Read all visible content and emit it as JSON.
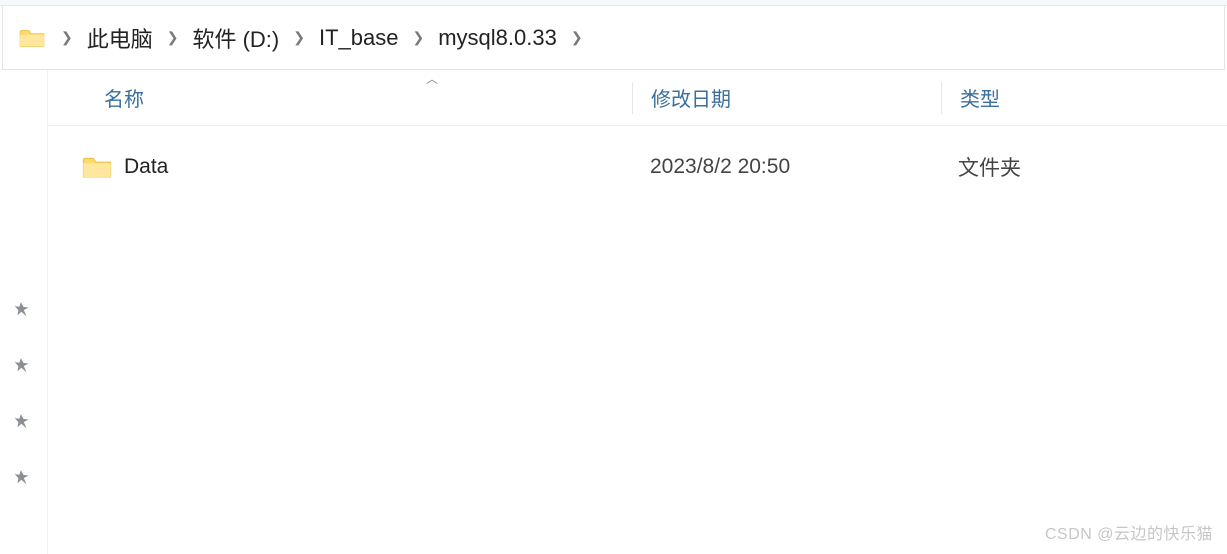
{
  "breadcrumb": {
    "segments": [
      {
        "label": "此电脑"
      },
      {
        "label": "软件 (D:)"
      },
      {
        "label": "IT_base"
      },
      {
        "label": "mysql8.0.33"
      }
    ]
  },
  "columns": {
    "name": "名称",
    "date": "修改日期",
    "type": "类型"
  },
  "files": [
    {
      "name": "Data",
      "date": "2023/8/2 20:50",
      "type": "文件夹",
      "kind": "folder"
    }
  ],
  "watermark": "CSDN @云边的快乐猫"
}
